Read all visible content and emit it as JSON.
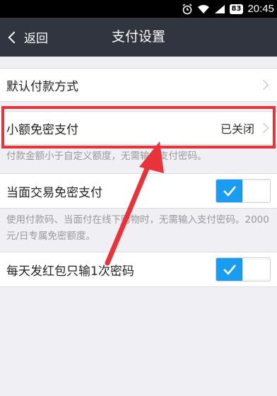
{
  "status_bar": {
    "battery": "83",
    "time": "20:45",
    "icons": [
      "alarm-clock-icon",
      "wifi-icon",
      "signal-icon",
      "battery-icon"
    ]
  },
  "nav": {
    "back_label": "返回",
    "title": "支付设置"
  },
  "rows": {
    "default_payment": {
      "label": "默认付款方式"
    },
    "small_no_pwd": {
      "label": "小额免密支付",
      "value": "已关闭"
    },
    "small_no_pwd_desc": "付款金额小于自定义额度，无需输入支付密码。",
    "face_to_face": {
      "label": "当面交易免密支付",
      "enabled": true
    },
    "face_to_face_desc": "使用付款码、当面付在线下购物时，无需输入支付密码。2000元/日专属免密额度。",
    "red_packet": {
      "label": "每天发红包只输1次密码",
      "enabled": true
    }
  },
  "colors": {
    "nav_bg": "#30353f",
    "toggle_on": "#1a9cf0",
    "annotation": "#e8333a"
  }
}
